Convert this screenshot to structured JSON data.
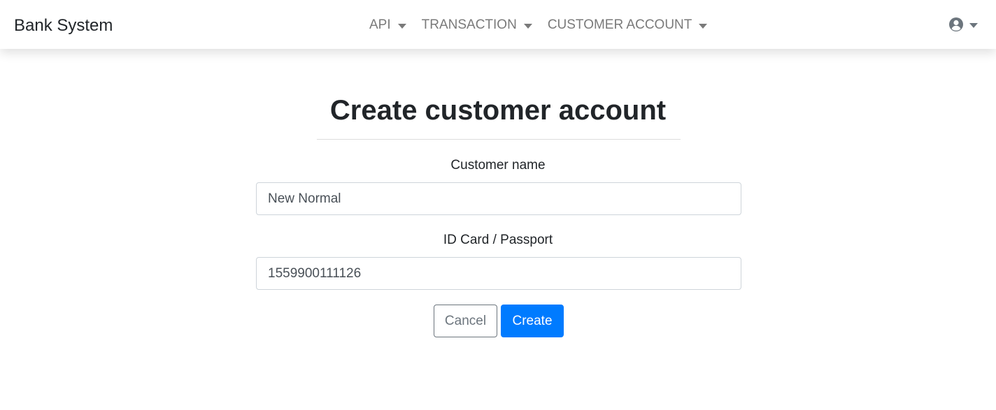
{
  "navbar": {
    "brand": "Bank System",
    "menus": [
      {
        "label": "API"
      },
      {
        "label": "TRANSACTION"
      },
      {
        "label": "CUSTOMER ACCOUNT"
      }
    ],
    "user_icon": "user-circle-icon"
  },
  "form": {
    "title": "Create customer account",
    "customer_name": {
      "label": "Customer name",
      "value": "New Normal"
    },
    "id_card": {
      "label": "ID Card / Passport",
      "value": "1559900111126"
    },
    "cancel_label": "Cancel",
    "create_label": "Create"
  },
  "colors": {
    "primary": "#007bff",
    "secondary": "#6c757d",
    "nav_text": "#7a7a7a"
  }
}
